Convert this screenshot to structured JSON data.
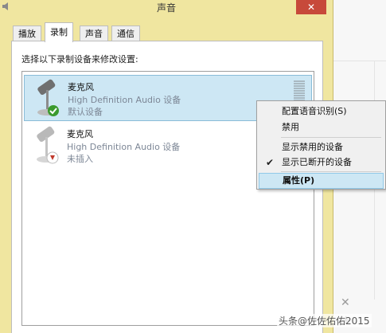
{
  "window": {
    "title": "声音",
    "close_glyph": "✕"
  },
  "tabs": [
    {
      "label": "播放",
      "active": false
    },
    {
      "label": "录制",
      "active": true
    },
    {
      "label": "声音",
      "active": false
    },
    {
      "label": "通信",
      "active": false
    }
  ],
  "panel": {
    "instruction": "选择以下录制设备来修改设置:"
  },
  "devices": [
    {
      "name": "麦克风",
      "driver": "High Definition Audio 设备",
      "status": "默认设备",
      "selected": true,
      "badge": "green-check"
    },
    {
      "name": "麦克风",
      "driver": "High Definition Audio 设备",
      "status": "未插入",
      "selected": false,
      "badge": "red-down-arrow"
    }
  ],
  "context_menu": {
    "items": [
      {
        "label": "配置语音识别(S)"
      },
      {
        "label": "禁用"
      },
      {
        "label": "显示禁用的设备"
      },
      {
        "label": "显示已断开的设备",
        "checked": true,
        "check_glyph": "✔"
      },
      {
        "label": "属性(P)",
        "highlighted": true
      }
    ]
  },
  "background": {
    "x_glyph": "✕",
    "plus_glyph": "+"
  },
  "watermark": {
    "text": "头条@佐佐佑佑2015"
  },
  "colors": {
    "window_frame": "#f0e6a0",
    "close_button": "#c7493a",
    "selection": "#cde7f4",
    "secondary_text": "#7d8796"
  }
}
